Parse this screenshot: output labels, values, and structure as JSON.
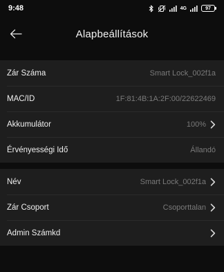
{
  "status_bar": {
    "time": "9:48",
    "bluetooth_icon": "bluetooth-icon",
    "mute_icon": "vibrate-off-icon",
    "network_label": "4G",
    "battery": "97"
  },
  "header": {
    "title": "Alapbeállítások",
    "back_icon": "arrow-left-icon"
  },
  "section_info": {
    "rows": [
      {
        "label": "Zár Száma",
        "value": "Smart Lock_002f1a"
      },
      {
        "label": "MAC/ID",
        "value": "1F:81:4B:1A:2F:00/22622469"
      },
      {
        "label": "Akkumulátor",
        "value": "100%"
      },
      {
        "label": "Érvényességi Idő",
        "value": "Állandó"
      }
    ]
  },
  "section_settings": {
    "rows": [
      {
        "label": "Név",
        "value": "Smart Lock_002f1a"
      },
      {
        "label": "Zár Csoport",
        "value": "Csoporttalan"
      },
      {
        "label": "Admin Számkd",
        "value": ""
      }
    ]
  },
  "colors": {
    "background": "#0d0d0d",
    "row_background": "#1e1e1e",
    "label_text": "#f0f0f0",
    "value_text": "#7a7a7a"
  }
}
